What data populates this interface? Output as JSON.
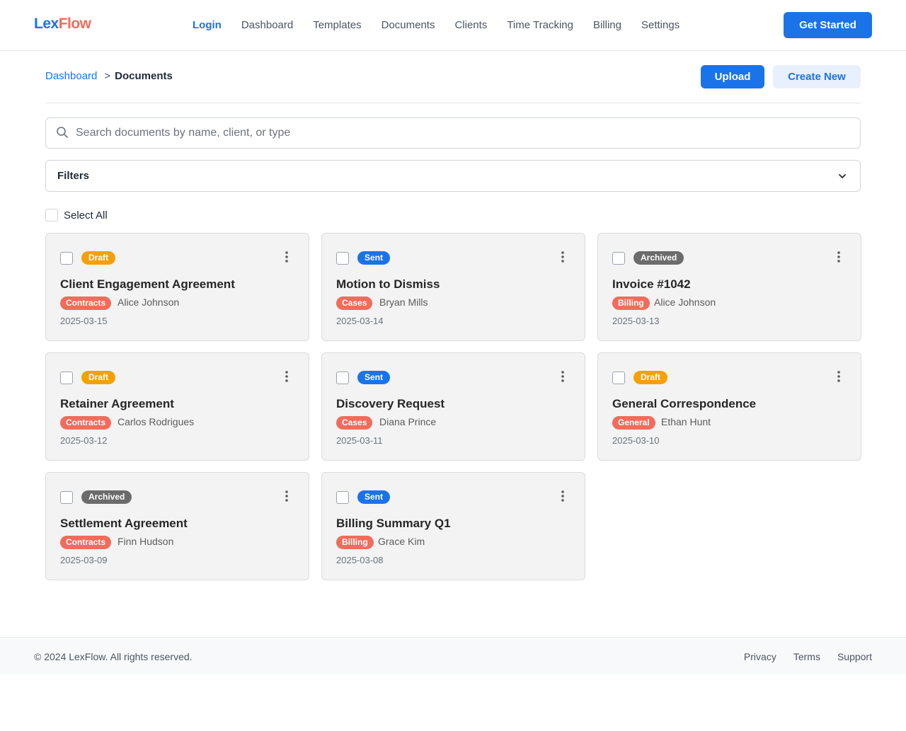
{
  "brand": {
    "name_part1": "Lex",
    "name_part2": "Flow"
  },
  "nav": {
    "items": [
      {
        "label": "Login",
        "active": true
      },
      {
        "label": "Dashboard"
      },
      {
        "label": "Templates"
      },
      {
        "label": "Documents"
      },
      {
        "label": "Clients"
      },
      {
        "label": "Time Tracking"
      },
      {
        "label": "Billing"
      },
      {
        "label": "Settings"
      }
    ],
    "cta_label": "Get Started"
  },
  "breadcrumb": {
    "parent": "Dashboard",
    "separator": ">",
    "current": "Documents"
  },
  "actions": {
    "upload_label": "Upload",
    "create_label": "Create New"
  },
  "search": {
    "placeholder": "Search documents by name, client, or type",
    "value": ""
  },
  "filters": {
    "label": "Filters"
  },
  "select_all": {
    "label": "Select All"
  },
  "documents": [
    {
      "status": "Draft",
      "title": "Client Engagement Agreement",
      "category": "Contracts",
      "client": "Alice Johnson",
      "date": "2025-03-15"
    },
    {
      "status": "Sent",
      "title": "Motion to Dismiss",
      "category": "Cases",
      "client": "Bryan Mills",
      "date": "2025-03-14"
    },
    {
      "status": "Archived",
      "title": "Invoice #1042",
      "category": "Billing",
      "client": "Alice Johnson",
      "date": "2025-03-13"
    },
    {
      "status": "Draft",
      "title": "Retainer Agreement",
      "category": "Contracts",
      "client": "Carlos Rodrigues",
      "date": "2025-03-12"
    },
    {
      "status": "Sent",
      "title": "Discovery Request",
      "category": "Cases",
      "client": "Diana Prince",
      "date": "2025-03-11"
    },
    {
      "status": "Draft",
      "title": "General Correspondence",
      "category": "General",
      "client": "Ethan Hunt",
      "date": "2025-03-10"
    },
    {
      "status": "Archived",
      "title": "Settlement Agreement",
      "category": "Contracts",
      "client": "Finn Hudson",
      "date": "2025-03-09"
    },
    {
      "status": "Sent",
      "title": "Billing Summary Q1",
      "category": "Billing",
      "client": "Grace Kim",
      "date": "2025-03-08"
    }
  ],
  "colors": {
    "accent": "#1a73e8",
    "brand_secondary": "#f26b5b",
    "status_draft": "#f5a00a",
    "status_sent": "#1a73e8",
    "status_archived": "#6b6b6b",
    "category": "#f26b5b"
  },
  "icons": {
    "search": "search-icon",
    "filters_toggle": "chevron-down-icon",
    "card_menu": "kebab-menu-icon"
  },
  "footer": {
    "copyright": "© 2024 LexFlow. All rights reserved.",
    "links": [
      "Privacy",
      "Terms",
      "Support"
    ]
  }
}
